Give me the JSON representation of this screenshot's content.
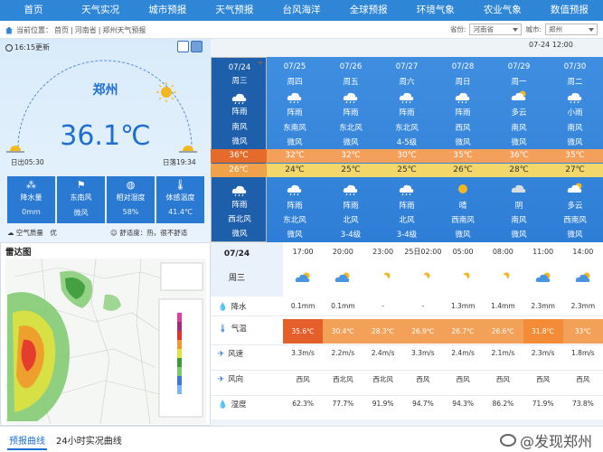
{
  "nav": [
    "首页",
    "天气实况",
    "城市预报",
    "天气预报",
    "台风海洋",
    "全球预报",
    "环境气象",
    "农业气象",
    "数值预报"
  ],
  "breadcrumb": {
    "prefix": "当前位置：",
    "items": [
      "首页",
      "河南省",
      "郑州天气预报"
    ],
    "sep": "|"
  },
  "selectors": {
    "province_label": "省份:",
    "province": "河南省",
    "city_label": "城市:",
    "city": "郑州",
    "date": "07-24 12:00"
  },
  "current": {
    "update": "16:15更新",
    "city": "郑州",
    "temp": "36.1℃",
    "sunrise": "日出05:30",
    "sunset": "日落19:34",
    "cards": [
      {
        "label": "降水量",
        "value": "0mm",
        "icon": "rain-drops-icon"
      },
      {
        "label": "东南风",
        "value": "微风",
        "icon": "wind-flag-icon"
      },
      {
        "label": "相对湿度",
        "value": "58%",
        "icon": "humidity-icon"
      },
      {
        "label": "体感温度",
        "value": "41.4℃",
        "icon": "thermometer-icon"
      }
    ],
    "air": "空气质量　优",
    "comfort": "舒适度：热，很不舒适"
  },
  "days": [
    {
      "date": "07/24",
      "week": "周三",
      "d_wx": "阵雨",
      "d_wind": "南风",
      "d_lvl": "微风",
      "high": "36℃",
      "low": "26℃",
      "n_wx": "阵雨",
      "n_wind": "西北风",
      "n_lvl": "微风",
      "d_icon": "rain",
      "n_icon": "rain"
    },
    {
      "date": "07/25",
      "week": "周四",
      "d_wx": "阵雨",
      "d_wind": "东南风",
      "d_lvl": "微风",
      "high": "32℃",
      "low": "24℃",
      "n_wx": "阵雨",
      "n_wind": "东北风",
      "n_lvl": "微风",
      "d_icon": "rain",
      "n_icon": "rain"
    },
    {
      "date": "07/26",
      "week": "周五",
      "d_wx": "阵雨",
      "d_wind": "东北风",
      "d_lvl": "微风",
      "high": "32℃",
      "low": "25℃",
      "n_wx": "阵雨",
      "n_wind": "北风",
      "n_lvl": "3-4级",
      "d_icon": "rain",
      "n_icon": "rain"
    },
    {
      "date": "07/27",
      "week": "周六",
      "d_wx": "阵雨",
      "d_wind": "东北风",
      "d_lvl": "4-5级",
      "high": "30℃",
      "low": "25℃",
      "n_wx": "阵雨",
      "n_wind": "北风",
      "n_lvl": "3-4级",
      "d_icon": "rain",
      "n_icon": "rain"
    },
    {
      "date": "07/28",
      "week": "周日",
      "d_wx": "阵雨",
      "d_wind": "西风",
      "d_lvl": "微风",
      "high": "35℃",
      "low": "26℃",
      "n_wx": "晴",
      "n_wind": "西南风",
      "n_lvl": "微风",
      "d_icon": "rain",
      "n_icon": "sun"
    },
    {
      "date": "07/29",
      "week": "周一",
      "d_wx": "多云",
      "d_wind": "南风",
      "d_lvl": "微风",
      "high": "36℃",
      "low": "28℃",
      "n_wx": "阴",
      "n_wind": "南风",
      "n_lvl": "微风",
      "d_icon": "cloud",
      "n_icon": "overcast"
    },
    {
      "date": "07/30",
      "week": "周二",
      "d_wx": "小雨",
      "d_wind": "南风",
      "d_lvl": "微风",
      "high": "35℃",
      "low": "27℃",
      "n_wx": "多云",
      "n_wind": "西南风",
      "n_lvl": "微风",
      "d_icon": "rain",
      "n_icon": "cloud"
    }
  ],
  "hourly": {
    "date": "07/24",
    "week": "周三",
    "times": [
      "17:00",
      "20:00",
      "23:00",
      "25日02:00",
      "05:00",
      "08:00",
      "11:00",
      "14:00"
    ],
    "icons": [
      "cloud-sun",
      "cloud-sun",
      "cloud",
      "cloud",
      "cloud",
      "cloud",
      "cloud-sun",
      "cloud-sun"
    ],
    "rows": [
      {
        "label": "降水",
        "icon": "raindrop-icon",
        "values": [
          "0.1mm",
          "0.1mm",
          "-",
          "-",
          "1.3mm",
          "1.4mm",
          "2.3mm",
          "2.3mm"
        ]
      },
      {
        "label": "气温",
        "icon": "thermometer-icon",
        "values": [
          "35.6℃",
          "30.4℃",
          "28.3℃",
          "26.9℃",
          "26.7℃",
          "26.6℃",
          "31.8℃",
          "33℃"
        ]
      },
      {
        "label": "风速",
        "icon": "wind-speed-icon",
        "values": [
          "3.3m/s",
          "2.2m/s",
          "2.4m/s",
          "3.3m/s",
          "2.4m/s",
          "2.1m/s",
          "2.3m/s",
          "1.8m/s"
        ]
      },
      {
        "label": "风向",
        "icon": "wind-direction-icon",
        "values": [
          "西风",
          "西北风",
          "西北风",
          "西风",
          "西风",
          "西风",
          "西风",
          "西风"
        ]
      },
      {
        "label": "湿度",
        "icon": "humidity-icon",
        "values": [
          "62.3%",
          "77.7%",
          "91.9%",
          "94.7%",
          "94.3%",
          "86.2%",
          "71.9%",
          "73.8%"
        ]
      }
    ]
  },
  "radar": {
    "title": "雷达图"
  },
  "tabs": [
    "预报曲线",
    "24小时实况曲线"
  ],
  "watermark": "@发现郑州"
}
